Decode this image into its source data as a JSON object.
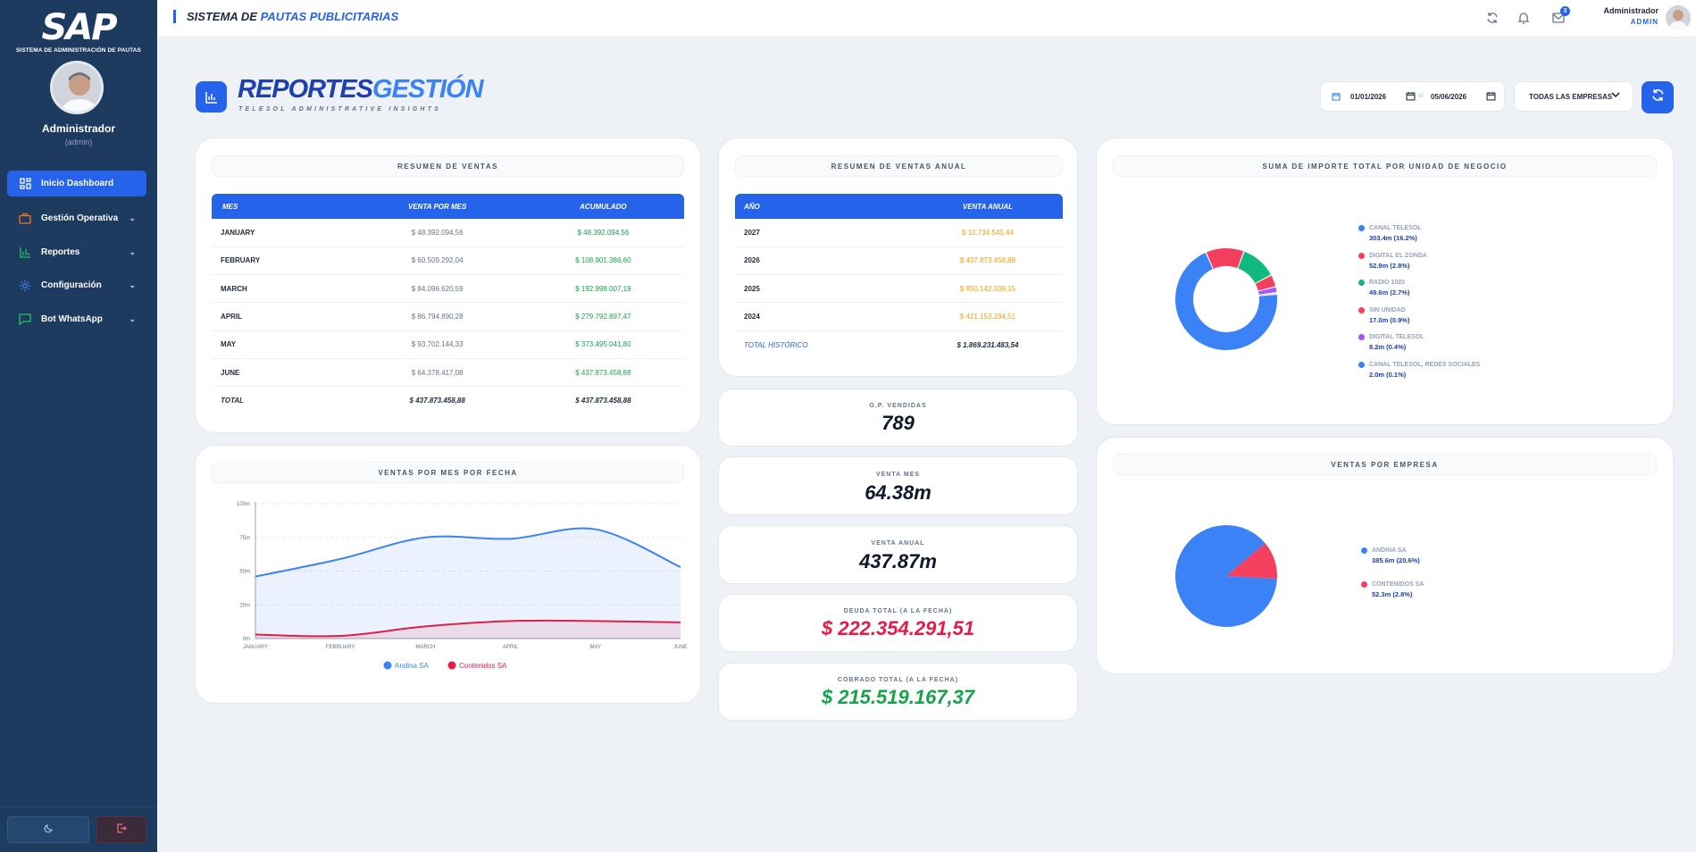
{
  "sidebar": {
    "logo": "SAP",
    "logo_subtitle": "SISTEMA DE ADMINISTRACIÓN DE PAUTAS",
    "user_name": "Administrador",
    "user_login": "(admin)",
    "items": [
      {
        "label": "Inicio Dashboard",
        "icon": "grid-icon"
      },
      {
        "label": "Gestión Operativa",
        "icon": "briefcase-icon"
      },
      {
        "label": "Reportes",
        "icon": "bar-chart-icon"
      },
      {
        "label": "Configuración",
        "icon": "gear-icon"
      },
      {
        "label": "Bot WhatsApp",
        "icon": "chat-icon"
      }
    ]
  },
  "topbar": {
    "title_a": "SISTEMA DE",
    "title_b": "PAUTAS PUBLICITARIAS",
    "mail_badge": "3",
    "user_name": "Administrador",
    "user_role": "ADMIN"
  },
  "header": {
    "title_a": "REPORTES",
    "title_b": "GESTIÓN",
    "subtitle": "TELESOL ADMINISTRATIVE INSIGHTS",
    "date_from": "01/01/2026",
    "date_sep": "al",
    "date_to": "05/06/2026",
    "company_filter": "TODAS LAS EMPRESAS"
  },
  "ventas_table": {
    "title": "RESUMEN DE VENTAS",
    "headers": [
      "MES",
      "VENTA POR MES",
      "ACUMULADO"
    ],
    "rows": [
      [
        "JANUARY",
        "$ 48.392.094,56",
        "$ 48.392.094,56"
      ],
      [
        "FEBRUARY",
        "$ 60.509.292,04",
        "$ 108.901.386,60"
      ],
      [
        "MARCH",
        "$ 84.096.620,59",
        "$ 192.998.007,19"
      ],
      [
        "APRIL",
        "$ 86.794.890,28",
        "$ 279.792.897,47"
      ],
      [
        "MAY",
        "$ 93.702.144,33",
        "$ 373.495.041,80"
      ],
      [
        "JUNE",
        "$ 64.378.417,08",
        "$ 437.873.458,88"
      ]
    ],
    "total": [
      "TOTAL",
      "$ 437.873.458,88",
      "$ 437.873.458,88"
    ]
  },
  "anual_table": {
    "title": "RESUMEN DE VENTAS ANUAL",
    "headers": [
      "AÑO",
      "VENTA ANUAL"
    ],
    "rows": [
      [
        "2027",
        "$ 10.734.545,44"
      ],
      [
        "2026",
        "$ 437.873.458,88"
      ],
      [
        "2025",
        "$ 850.142.039,15"
      ],
      [
        "2024",
        "$ 421.153.294,51"
      ]
    ],
    "total": [
      "TOTAL HISTÓRICO",
      "$ 1.869.231.483,54"
    ]
  },
  "stats": [
    {
      "label": "O.P. VENDIDAS",
      "value": "789"
    },
    {
      "label": "VENTA MES",
      "value": "64.38m"
    },
    {
      "label": "VENTA ANUAL",
      "value": "437.87m"
    },
    {
      "label": "DEUDA TOTAL (A LA FECHA)",
      "value": "$ 222.354.291,51"
    },
    {
      "label": "COBRADO TOTAL (A LA FECHA)",
      "value": "$ 215.519.167,37"
    }
  ],
  "colors": {
    "primary": "#2563eb",
    "sidebar": "#1d3a5f",
    "green": "#16a34a",
    "red": "#e11d48",
    "orange": "#f59e0b"
  },
  "chart_data": [
    {
      "type": "area",
      "title": "VENTAS POR MES POR FECHA",
      "categories": [
        "JANUARY",
        "FEBRUARY",
        "MARCH",
        "APRIL",
        "MAY",
        "JUNE"
      ],
      "yticks": [
        "0m",
        "25m",
        "50m",
        "75m",
        "100m"
      ],
      "ylim": [
        0,
        100
      ],
      "series": [
        {
          "name": "Andina SA",
          "color": "#3b82f6",
          "values": [
            46,
            59,
            75,
            74,
            81,
            53
          ]
        },
        {
          "name": "Contenidos SA",
          "color": "#e11d48",
          "values": [
            3,
            2,
            9,
            13,
            13,
            12
          ]
        }
      ],
      "legend": "bottom"
    },
    {
      "type": "pie",
      "title": "SUMA DE IMPORTE TOTAL POR UNIDAD DE NEGOCIO",
      "donut": true,
      "slices": [
        {
          "name": "CANAL TELESOL",
          "value": 303.4,
          "label": "303.4m (16.2%)",
          "color": "#3b82f6"
        },
        {
          "name": "DIGITAL EL ZONDA",
          "value": 52.9,
          "label": "52.9m (2.8%)",
          "color": "#f43f5e"
        },
        {
          "name": "RADIO 1020",
          "value": 49.6,
          "label": "49.6m (2.7%)",
          "color": "#10b981"
        },
        {
          "name": "SIN UNIDAD",
          "value": 17.0,
          "label": "17.0m (0.9%)",
          "color": "#f43f5e"
        },
        {
          "name": "DIGITAL TELESOL",
          "value": 8.2,
          "label": "8.2m (0.4%)",
          "color": "#a855f7"
        },
        {
          "name": "CANAL TELESOL, REDES SOCIALES",
          "value": 2.0,
          "label": "2.0m (0.1%)",
          "color": "#3b82f6"
        }
      ],
      "legend": "right"
    },
    {
      "type": "pie",
      "title": "VENTAS POR EMPRESA",
      "slices": [
        {
          "name": "ANDINA SA",
          "value": 385.6,
          "label": "385.6m (20.6%)",
          "color": "#3b82f6"
        },
        {
          "name": "CONTENIDOS SA",
          "value": 52.3,
          "label": "52.3m (2.8%)",
          "color": "#f43f5e"
        }
      ],
      "legend": "right"
    }
  ]
}
